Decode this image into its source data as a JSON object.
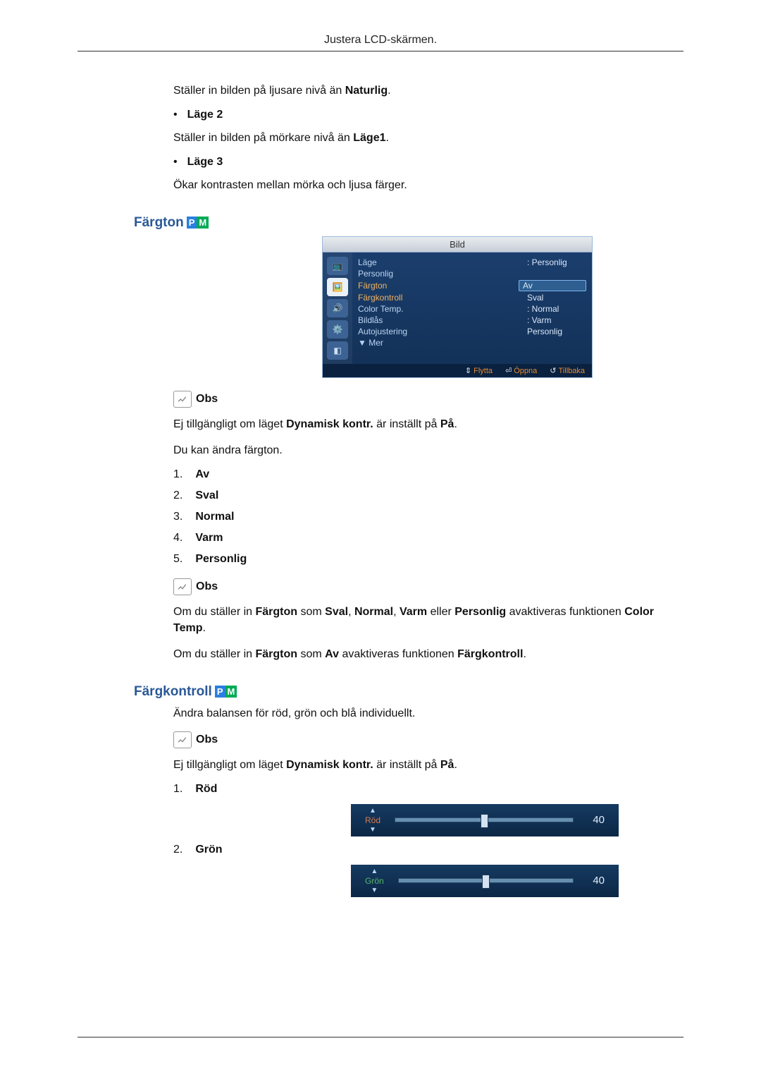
{
  "header": {
    "title": "Justera LCD-skärmen."
  },
  "intro": {
    "line1_pre": "Ställer in bilden på ljusare nivå än ",
    "line1_bold": "Naturlig",
    "mode2_label": "Läge 2",
    "mode2_desc_pre": "Ställer in bilden på mörkare nivå än ",
    "mode2_desc_bold": "Läge1",
    "mode3_label": "Läge 3",
    "mode3_desc": "Ökar kontrasten mellan mörka och ljusa färger."
  },
  "section_fargton": {
    "title": "Färgton",
    "osd": {
      "title": "Bild",
      "rows": [
        {
          "k": "Läge",
          "v": ": Personlig",
          "orange": false
        },
        {
          "k": "Personlig",
          "v": "",
          "orange": false
        },
        {
          "k": "Färgton",
          "v": "Av",
          "orange": true,
          "highlight": true
        },
        {
          "k": "Färgkontroll",
          "v": "Sval",
          "orange": true
        },
        {
          "k": "Color Temp.",
          "v": ": Normal",
          "orange": false
        },
        {
          "k": "Bildlås",
          "v": ": Varm",
          "orange": false
        },
        {
          "k": "Autojustering",
          "v": "Personlig",
          "orange": false
        },
        {
          "k": "▼ Mer",
          "v": "",
          "orange": false
        }
      ],
      "footer": [
        {
          "sym": "⇕",
          "label": "Flytta"
        },
        {
          "sym": "⏎",
          "label": "Öppna"
        },
        {
          "sym": "↺",
          "label": "Tillbaka"
        }
      ]
    }
  },
  "obs1": {
    "label": "Obs",
    "l1_pre": "Ej tillgängligt om läget ",
    "l1_b1": "Dynamisk kontr.",
    "l1_mid": " är inställt på ",
    "l1_b2": "På",
    "l2": "Du kan ändra färgton."
  },
  "options": [
    {
      "num": "1.",
      "label": "Av"
    },
    {
      "num": "2.",
      "label": "Sval"
    },
    {
      "num": "3.",
      "label": "Normal"
    },
    {
      "num": "4.",
      "label": "Varm"
    },
    {
      "num": "5.",
      "label": "Personlig"
    }
  ],
  "obs2": {
    "label": "Obs",
    "p1_a": "Om du ställer in ",
    "p1_b": "Färgton",
    "p1_c": " som ",
    "p1_d": "Sval",
    "p1_e": ", ",
    "p1_f": "Normal",
    "p1_g": ", ",
    "p1_h": "Varm",
    "p1_i": " eller ",
    "p1_j": "Personlig",
    "p1_k": " avaktiveras funktionen ",
    "p1_l": "Color Temp",
    "p1_m": ".",
    "p2_a": "Om du ställer in ",
    "p2_b": "Färgton",
    "p2_c": " som ",
    "p2_d": "Av",
    "p2_e": " avaktiveras funktionen ",
    "p2_f": "Färgkontroll",
    "p2_g": "."
  },
  "section_fargkontroll": {
    "title": "Färgkontroll",
    "desc": "Ändra balansen för röd, grön och blå individuellt."
  },
  "obs3": {
    "label": "Obs",
    "l1_pre": "Ej tillgängligt om läget ",
    "l1_b1": "Dynamisk kontr.",
    "l1_mid": " är inställt på ",
    "l1_b2": "På"
  },
  "sliders": [
    {
      "num": "1.",
      "label": "Röd",
      "name": "Röd",
      "value": "40",
      "class": ""
    },
    {
      "num": "2.",
      "label": "Grön",
      "name": "Grön",
      "value": "40",
      "class": "green"
    }
  ]
}
